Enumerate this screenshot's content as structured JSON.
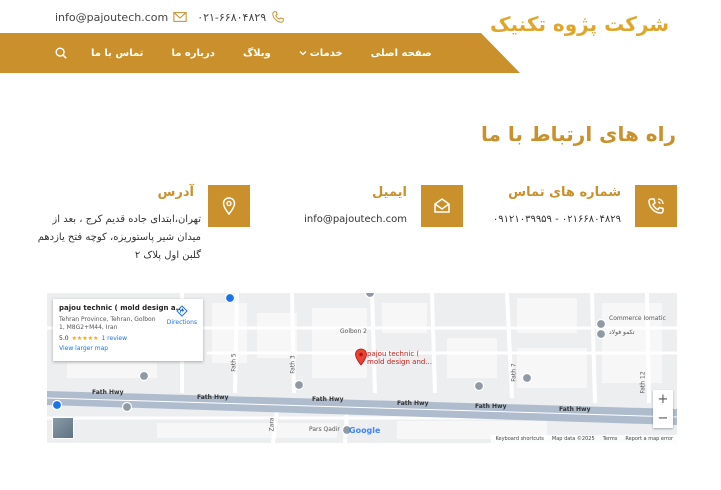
{
  "header": {
    "brand": "شرکت پژوه تکنیک",
    "phone": "۰۲۱-۶۶۸۰۴۸۲۹",
    "email": "info@pajoutech.com"
  },
  "nav": {
    "items": [
      "تماس با ما",
      "درباره ما",
      "وبلاگ",
      "خدمات",
      "صفحه اصلی"
    ]
  },
  "section": {
    "title": "راه های ارتباط با ما"
  },
  "contacts": {
    "phone": {
      "title": "شماره های تماس",
      "value": "۰۲۱۶۶۸۰۴۸۲۹ - ۰۹۱۲۱۰۳۹۹۵۹"
    },
    "email": {
      "title": "ایمیل",
      "value": "info@pajoutech.com"
    },
    "address": {
      "title": "آدرس",
      "line1": "تهران،ابتدای جاده قدیم کرج ، بعد از",
      "line2": "میدان شیر پاستوریزه، کوچه فتح یازدهم",
      "line3": "گلبن اول پلاک ۲"
    }
  },
  "map": {
    "place_name": "pajou technic ( mold design a...",
    "address": "Tehran Province, Tehran, Golbon 1, M8G2+M44, Iran",
    "rating": "5.0",
    "stars": "★★★★★",
    "reviews": "1 review",
    "larger_map": "View larger map",
    "directions": "Directions",
    "pin_label_1": "pajou technic (",
    "pin_label_2": "mold design and...",
    "streets": {
      "golbon": "Golbon 2",
      "fath_hwy": "Fath Hwy",
      "fath5": "Fath 5",
      "fath3": "Fath 3",
      "fath7": "Fath 7",
      "fath12": "Fath 12",
      "pars_qadir": "Pars Qadir",
      "commerce": "Commerce Iomatic",
      "takmo": "تکمو فولاد",
      "zara": "Zara"
    },
    "zoom_in": "+",
    "zoom_out": "−",
    "google": "Google",
    "footer": [
      "Keyboard shortcuts",
      "Map data ©2025",
      "Terms",
      "Report a map error"
    ]
  },
  "colors": {
    "accent": "#c9902b",
    "brand": "#e0a62c"
  }
}
